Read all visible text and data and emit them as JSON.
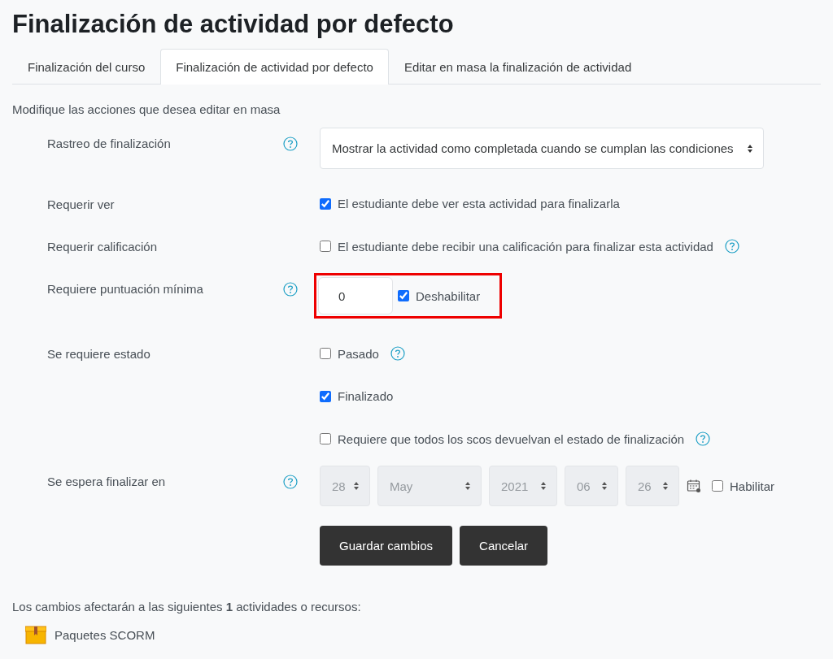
{
  "title": "Finalización de actividad por defecto",
  "tabs": [
    {
      "label": "Finalización del curso",
      "selected": false
    },
    {
      "label": "Finalización de actividad por defecto",
      "selected": true
    },
    {
      "label": "Editar en masa la finalización de actividad",
      "selected": false
    }
  ],
  "intro": "Modifique las acciones que desea editar en masa",
  "rows": [
    {
      "kind": "select",
      "label": "Rastreo de finalización",
      "help": true,
      "value": "Mostrar la actividad como completada cuando se cumplan las condiciones"
    },
    {
      "kind": "checks",
      "label": "Requerir ver",
      "help": false,
      "options": [
        {
          "label": "El estudiante debe ver esta actividad para finalizarla",
          "checked": true,
          "help": false
        }
      ]
    },
    {
      "kind": "checks",
      "label": "Requerir calificación",
      "help": false,
      "options": [
        {
          "label": "El estudiante debe recibir una calificación para finalizar esta actividad",
          "checked": false,
          "help": true
        }
      ]
    },
    {
      "kind": "number",
      "label": "Requiere puntuación mínima",
      "help": true,
      "highlighted": true,
      "value": "0",
      "toggle": {
        "label": "Deshabilitar",
        "checked": true
      }
    },
    {
      "kind": "checks",
      "label": "Se requiere estado",
      "help": false,
      "options": [
        {
          "label": "Pasado",
          "checked": false,
          "help": true
        },
        {
          "label": "Finalizado",
          "checked": true,
          "help": false
        },
        {
          "label": "Requiere que todos los scos devuelvan el estado de finalización",
          "checked": false,
          "help": true
        }
      ]
    },
    {
      "kind": "date",
      "label": "Se espera finalizar en",
      "help": true,
      "disabled": true,
      "parts": [
        "28",
        "May",
        "2021",
        "06",
        "26"
      ],
      "toggle": {
        "label": "Habilitar",
        "checked": false
      }
    }
  ],
  "buttons": [
    {
      "label": "Guardar cambios"
    },
    {
      "label": "Cancelar"
    }
  ],
  "summary": "Los cambios afectarán a las siguientes **1** actividades o recursos:",
  "activities": [
    {
      "label": "Paquetes SCORM"
    }
  ]
}
